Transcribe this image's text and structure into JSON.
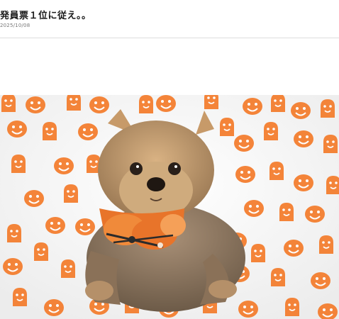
{
  "post": {
    "title": "発員票１位に従え。。",
    "date": "2025/10/08"
  },
  "photo": {
    "subject": "dog-photo",
    "colors": {
      "pumpkin": "#f47b2a",
      "backdrop": "#f6f6f6",
      "fur_light": "#c8a070",
      "fur_dark": "#6e5a44",
      "bandana_orange": "#e8742a"
    }
  }
}
